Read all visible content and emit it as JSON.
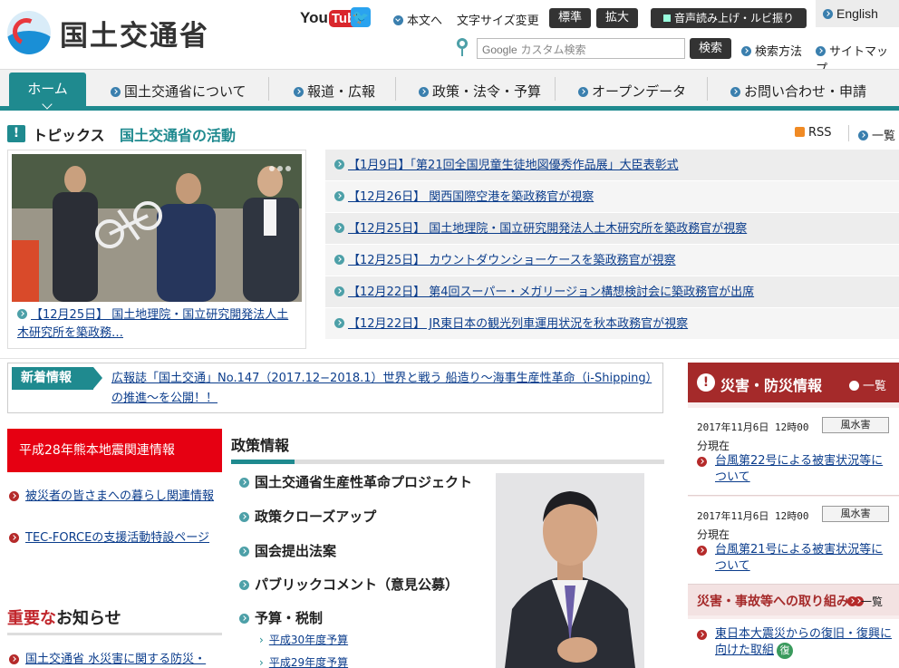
{
  "header": {
    "logo_text": "国土交通省",
    "youtube_you": "You",
    "youtube_tube": "Tube",
    "skip_link": "本文へ",
    "font_size_label": "文字サイズ変更",
    "font_standard": "標準",
    "font_large": "拡大",
    "voice_button": "音声読み上げ・ルビ振り",
    "english": "English",
    "search_placeholder_brand": "Google",
    "search_placeholder": "カスタム検索",
    "search_button": "検索",
    "search_help": "検索方法",
    "sitemap": "サイトマップ"
  },
  "nav": {
    "items": [
      "ホーム",
      "国土交通省について",
      "報道・広報",
      "政策・法令・予算",
      "オープンデータ",
      "お問い合わせ・申請"
    ]
  },
  "topics": {
    "label": "トピックス",
    "title": "国土交通省の活動",
    "rss": "RSS",
    "all": "一覧",
    "photo_caption": "【12月25日】 国土地理院・国立研究開発法人土木研究所を築政務…",
    "list": [
      "【1月9日】「第21回全国児童生徒地図優秀作品展」大臣表彰式",
      "【12月26日】 関西国際空港を築政務官が視察",
      "【12月25日】 国土地理院・国立研究開発法人土木研究所を築政務官が視察",
      "【12月25日】 カウントダウンショーケースを築政務官が視察",
      "【12月22日】 第4回スーパー・メガリージョン構想検討会に築政務官が出席",
      "【12月22日】 JR東日本の観光列車運用状況を秋本政務官が視察"
    ]
  },
  "news": {
    "tag": "新着情報",
    "text": "広報誌「国土交通」No.147（2017.12−2018.1）世界と戦う 船造り〜海事生産性革命（i-Shipping）の推進〜を公開！！"
  },
  "left": {
    "kumamoto": "平成28年熊本地震関連情報",
    "links": [
      "被災者の皆さまへの暮らし関連情報",
      "TEC-FORCEの支援活動特設ページ"
    ],
    "notice_red": "重要な",
    "notice_rest": "お知らせ",
    "notice_link": "国土交通省 水災害に関する防災・"
  },
  "policy": {
    "title": "政策情報",
    "items": [
      "国土交通省生産性革命プロジェクト",
      "政策クローズアップ",
      "国会提出法案",
      "パブリックコメント（意見公募）",
      "予算・税制"
    ],
    "sub": [
      "平成30年度予算",
      "平成29年度予算"
    ]
  },
  "disaster": {
    "title": "災害・防災情報",
    "all": "一覧",
    "items": [
      {
        "date": "2017年11月6日 12時00",
        "badge": "風水害",
        "bunya": "分現在",
        "link": "台風第22号による被害状況等について"
      },
      {
        "date": "2017年11月6日 12時00",
        "badge": "風水害",
        "bunya": "分現在",
        "link": "台風第21号による被害状況等について"
      }
    ],
    "torikumi": "災害・事故等への取り組み",
    "torikumi_all": "一覧",
    "torikumi_link": "東日本大震災からの復旧・復興に向けた取組",
    "fuku": "復"
  },
  "colors": {
    "teal": "#1f8a8f",
    "red": "#e60012",
    "disaster": "#a52a2a",
    "link": "#0b3d8c"
  },
  "icons": [
    "logo-mark-icon",
    "twitter-icon",
    "location-pin-icon",
    "rss-icon",
    "exclamation-icon",
    "speaker-icon"
  ]
}
